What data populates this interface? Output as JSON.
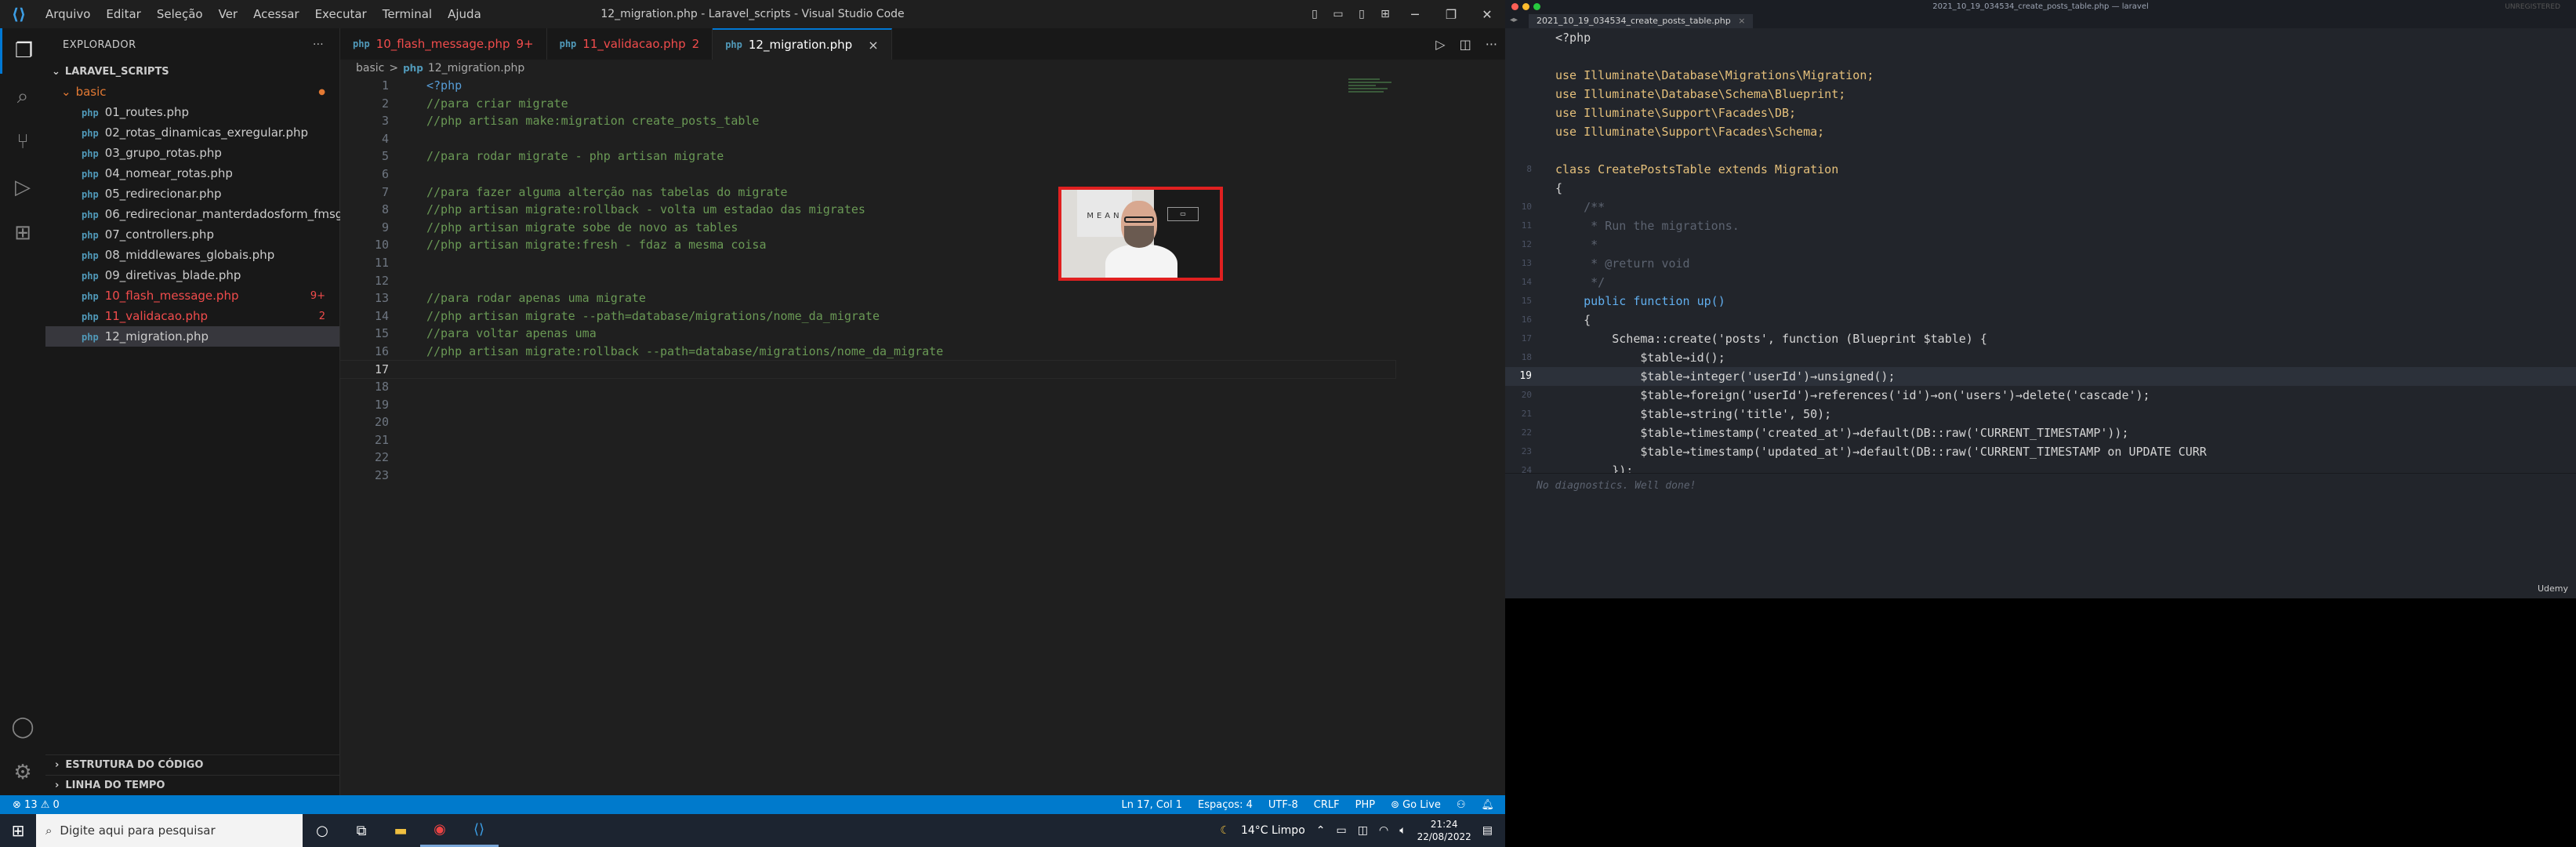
{
  "vscode": {
    "window_title": "12_migration.php - Laravel_scripts - Visual Studio Code",
    "menu": [
      "Arquivo",
      "Editar",
      "Seleção",
      "Ver",
      "Acessar",
      "Executar",
      "Terminal",
      "Ajuda"
    ],
    "sidebar": {
      "header": "EXPLORADOR",
      "root": "LARAVEL_SCRIPTS",
      "folder": "basic",
      "files": [
        {
          "name": "01_routes.php",
          "badge": "",
          "error": false,
          "active": false
        },
        {
          "name": "02_rotas_dinamicas_exregular.php",
          "badge": "",
          "error": false,
          "active": false
        },
        {
          "name": "03_grupo_rotas.php",
          "badge": "",
          "error": false,
          "active": false
        },
        {
          "name": "04_nomear_rotas.php",
          "badge": "",
          "error": false,
          "active": false
        },
        {
          "name": "05_redirecionar.php",
          "badge": "",
          "error": false,
          "active": false
        },
        {
          "name": "06_redirecionar_manterdadosform_fmsg.php",
          "badge": "",
          "error": false,
          "active": false
        },
        {
          "name": "07_controllers.php",
          "badge": "",
          "error": false,
          "active": false
        },
        {
          "name": "08_middlewares_globais.php",
          "badge": "",
          "error": false,
          "active": false
        },
        {
          "name": "09_diretivas_blade.php",
          "badge": "",
          "error": false,
          "active": false
        },
        {
          "name": "10_flash_message.php",
          "badge": "9+",
          "error": true,
          "active": false
        },
        {
          "name": "11_validacao.php",
          "badge": "2",
          "error": true,
          "active": false
        },
        {
          "name": "12_migration.php",
          "badge": "",
          "error": false,
          "active": true
        }
      ],
      "outline": "ESTRUTURA DO CÓDIGO",
      "timeline": "LINHA DO TEMPO"
    },
    "tabs": [
      {
        "label": "10_flash_message.php",
        "badge": "9+",
        "error": true,
        "active": false
      },
      {
        "label": "11_validacao.php",
        "badge": "2",
        "error": true,
        "active": false
      },
      {
        "label": "12_migration.php",
        "badge": "",
        "error": false,
        "active": true
      }
    ],
    "breadcrumb": {
      "folder": "basic",
      "sep": ">",
      "file": "12_migration.php"
    },
    "code_lines": [
      "<?php",
      "//para criar migrate",
      "//php artisan make:migration create_posts_table",
      "",
      "//para rodar migrate - php artisan migrate",
      "",
      "//para fazer alguma alterção nas tabelas do migrate",
      "//php artisan migrate:rollback - volta um estadao das migrates",
      "//php artisan migrate sobe de novo as tables",
      "//php artisan migrate:fresh - fdaz a mesma coisa",
      "",
      "",
      "//para rodar apenas uma migrate",
      "//php artisan migrate --path=database/migrations/nome_da_migrate",
      "//para voltar apenas uma",
      "//php artisan migrate:rollback --path=database/migrations/nome_da_migrate",
      "",
      "",
      "",
      "",
      "",
      "",
      ""
    ],
    "current_line": 17,
    "status": {
      "problems": "13",
      "warnings": "0",
      "position": "Ln 17, Col 1",
      "spaces": "Espaços: 4",
      "encoding": "UTF-8",
      "eol": "CRLF",
      "language": "PHP",
      "go_live": "Go Live"
    }
  },
  "taskbar": {
    "search_placeholder": "Digite aqui para pesquisar",
    "weather": "14°C  Limpo",
    "time": "21:24",
    "date": "22/08/2022"
  },
  "recording": {
    "window_title": "2021_10_19_034534_create_posts_table.php — laravel",
    "unregistered": "UNREGISTERED",
    "tab": "2021_10_19_034534_create_posts_table.php",
    "diagnostics": "No diagnostics. Well done!",
    "watermark": "Udemy",
    "current_line": "19",
    "code_lines": [
      {
        "n": "",
        "t": "<?php"
      },
      {
        "n": "",
        "t": ""
      },
      {
        "n": "",
        "t": "use Illuminate\\Database\\Migrations\\Migration;"
      },
      {
        "n": "",
        "t": "use Illuminate\\Database\\Schema\\Blueprint;"
      },
      {
        "n": "",
        "t": "use Illuminate\\Support\\Facades\\DB;"
      },
      {
        "n": "",
        "t": "use Illuminate\\Support\\Facades\\Schema;"
      },
      {
        "n": "",
        "t": ""
      },
      {
        "n": "8",
        "t": "class CreatePostsTable extends Migration"
      },
      {
        "n": "",
        "t": "{"
      },
      {
        "n": "10",
        "t": "    /**"
      },
      {
        "n": "11",
        "t": "     * Run the migrations."
      },
      {
        "n": "12",
        "t": "     *"
      },
      {
        "n": "13",
        "t": "     * @return void"
      },
      {
        "n": "14",
        "t": "     */"
      },
      {
        "n": "15",
        "t": "    public function up()"
      },
      {
        "n": "16",
        "t": "    {"
      },
      {
        "n": "17",
        "t": "        Schema::create('posts', function (Blueprint $table) {"
      },
      {
        "n": "18",
        "t": "            $table→id();"
      },
      {
        "n": "19",
        "t": "            $table→integer('userId')→unsigned();"
      },
      {
        "n": "20",
        "t": "            $table→foreign('userId')→references('id')→on('users')→delete('cascade');"
      },
      {
        "n": "21",
        "t": "            $table→string('title', 50);"
      },
      {
        "n": "22",
        "t": "            $table→timestamp('created_at')→default(DB::raw('CURRENT_TIMESTAMP'));"
      },
      {
        "n": "23",
        "t": "            $table→timestamp('updated_at')→default(DB::raw('CURRENT_TIMESTAMP on UPDATE CURR"
      },
      {
        "n": "24",
        "t": "        });"
      }
    ],
    "webcam_poster": "MEAN"
  }
}
